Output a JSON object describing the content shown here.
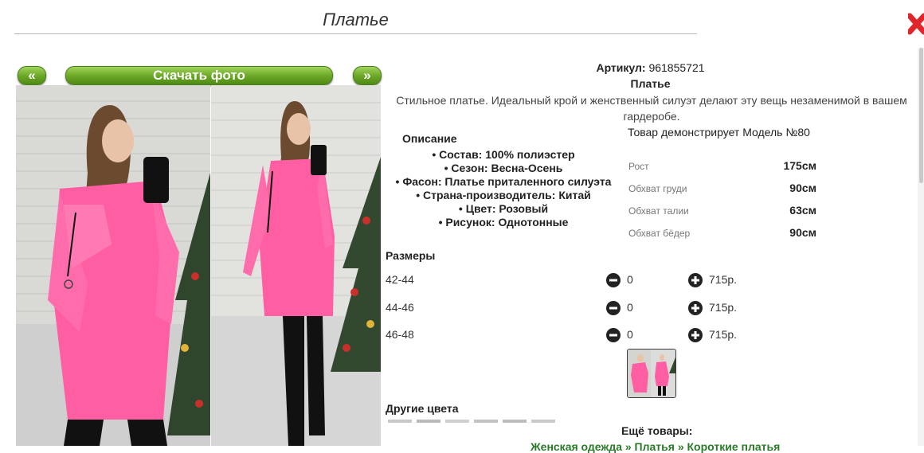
{
  "page": {
    "title": "Платье"
  },
  "gallery": {
    "prev_label": "«",
    "next_label": "»",
    "download_label": "Скачать фото"
  },
  "product": {
    "article_label": "Артикул:",
    "article_value": "961855721",
    "name": "Платье",
    "description": "Стильное платье. Идеальный крой и женственный силуэт делают эту вещь незаменимой в вашем гардеробе.",
    "model_text": "Товар демонстрирует Модель №80"
  },
  "specs": {
    "title": "Описание",
    "items": [
      "Состав: 100% полиэстер",
      "Сезон: Весна-Осень",
      "Фасон: Платье приталенного силуэта",
      "Страна-производитель: Китай",
      "Цвет: Розовый",
      "Рисунок: Однотонные"
    ]
  },
  "measurements": [
    {
      "label": "Рост",
      "value": "175см"
    },
    {
      "label": "Обхват груди",
      "value": "90см"
    },
    {
      "label": "Обхват талии",
      "value": "63см"
    },
    {
      "label": "Обхват бёдер",
      "value": "90см"
    }
  ],
  "sizes": {
    "title": "Размеры",
    "rows": [
      {
        "size": "42-44",
        "qty": "0",
        "price": "715р."
      },
      {
        "size": "44-46",
        "qty": "0",
        "price": "715р."
      },
      {
        "size": "46-48",
        "qty": "0",
        "price": "715р."
      }
    ]
  },
  "other_colors": {
    "title": "Другие цвета"
  },
  "more": {
    "title": "Ещё товары:",
    "links_text": "Женская одежда » Платья » Короткие платья"
  },
  "colors": {
    "accent_green": "#6aa525",
    "dress_pink": "#ff5fa2",
    "close_red": "#e0252b"
  },
  "icons": {
    "close": "close-x-icon",
    "minus": "minus-circle-icon",
    "plus": "plus-circle-icon"
  }
}
